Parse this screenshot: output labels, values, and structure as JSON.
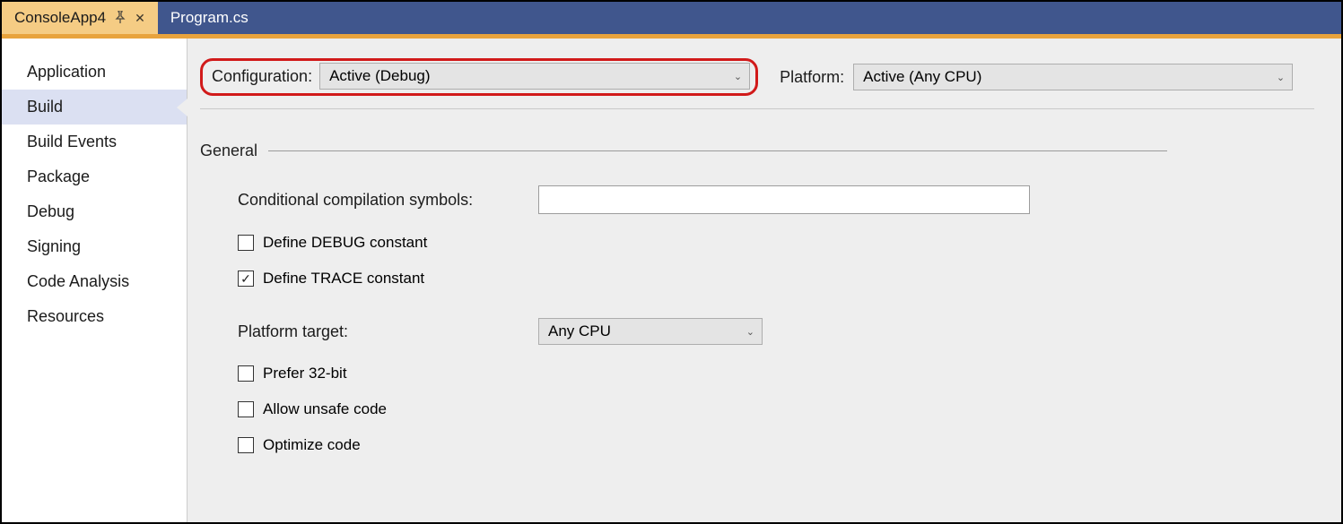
{
  "tabs": {
    "active": "ConsoleApp4",
    "other": "Program.cs"
  },
  "sidebar": {
    "items": [
      {
        "label": "Application"
      },
      {
        "label": "Build"
      },
      {
        "label": "Build Events"
      },
      {
        "label": "Package"
      },
      {
        "label": "Debug"
      },
      {
        "label": "Signing"
      },
      {
        "label": "Code Analysis"
      },
      {
        "label": "Resources"
      }
    ],
    "selected_index": 1
  },
  "toprow": {
    "configuration_label": "Configuration:",
    "configuration_value": "Active (Debug)",
    "platform_label": "Platform:",
    "platform_value": "Active (Any CPU)"
  },
  "section_general": {
    "title": "General",
    "conditional_symbols_label": "Conditional compilation symbols:",
    "conditional_symbols_value": "",
    "define_debug_label": "Define DEBUG constant",
    "define_debug_checked": false,
    "define_trace_label": "Define TRACE constant",
    "define_trace_checked": true,
    "platform_target_label": "Platform target:",
    "platform_target_value": "Any CPU",
    "prefer_32bit_label": "Prefer 32-bit",
    "prefer_32bit_checked": false,
    "allow_unsafe_label": "Allow unsafe code",
    "allow_unsafe_checked": false,
    "optimize_label": "Optimize code",
    "optimize_checked": false
  }
}
